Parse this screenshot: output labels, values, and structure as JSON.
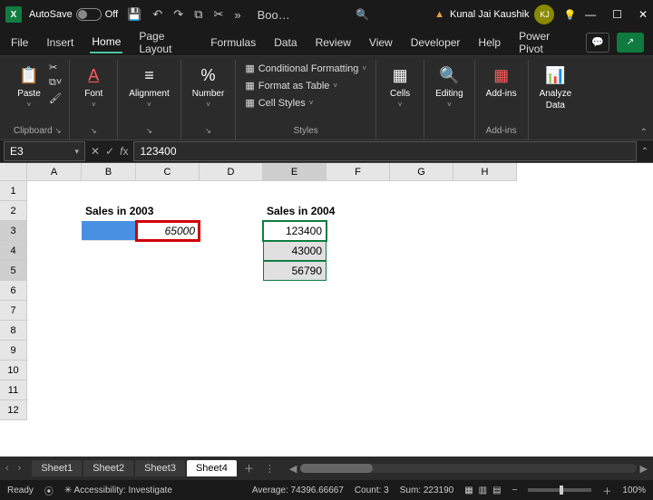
{
  "titlebar": {
    "logo": "X",
    "autosave_label": "AutoSave",
    "autosave_state": "Off",
    "doc_name": "Boo…",
    "search_placeholder": "",
    "user_name": "Kunal Jai Kaushik",
    "user_initials": "KJ"
  },
  "menu": {
    "tabs": [
      "File",
      "Insert",
      "Home",
      "Page Layout",
      "Formulas",
      "Data",
      "Review",
      "View",
      "Developer",
      "Help",
      "Power Pivot"
    ],
    "active": "Home"
  },
  "ribbon": {
    "clipboard": {
      "paste": "Paste",
      "label": "Clipboard"
    },
    "font": {
      "btn": "Font",
      "label": "Font"
    },
    "alignment": {
      "btn": "Alignment",
      "label": ""
    },
    "number": {
      "btn": "Number",
      "label": ""
    },
    "styles": {
      "cond": "Conditional Formatting",
      "table": "Format as Table",
      "cell": "Cell Styles",
      "label": "Styles"
    },
    "cells": {
      "btn": "Cells"
    },
    "editing": {
      "btn": "Editing"
    },
    "addins": {
      "btn": "Add-ins",
      "label": "Add-ins"
    },
    "analyze": {
      "btn": "Analyze",
      "btn2": "Data"
    }
  },
  "fx": {
    "namebox": "E3",
    "formula": "123400"
  },
  "grid": {
    "cols": [
      "A",
      "B",
      "C",
      "D",
      "E",
      "F",
      "G",
      "H"
    ],
    "rows": [
      "1",
      "2",
      "3",
      "4",
      "5",
      "6",
      "7",
      "8",
      "9",
      "10",
      "11",
      "12"
    ],
    "b2": "Sales in 2003",
    "c3": "65000",
    "e2": "Sales in 2004",
    "e3": "123400",
    "e4": "43000",
    "e5": "56790"
  },
  "sheets": {
    "tabs": [
      "Sheet1",
      "Sheet2",
      "Sheet3",
      "Sheet4"
    ],
    "active": "Sheet4"
  },
  "status": {
    "ready": "Ready",
    "access": "Accessibility: Investigate",
    "avg": "Average: 74396.66667",
    "count": "Count: 3",
    "sum": "Sum: 223190",
    "zoom": "100%"
  }
}
